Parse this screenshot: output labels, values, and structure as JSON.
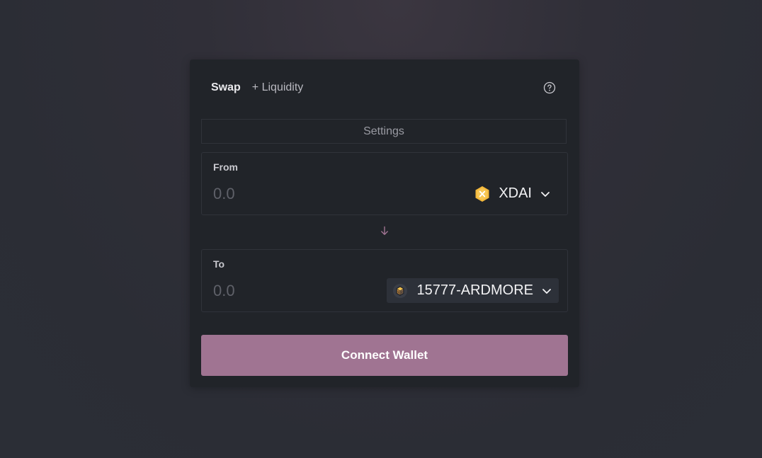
{
  "nav": {
    "tabs": [
      {
        "label": "Swap",
        "active": true
      },
      {
        "label": "+ Liquidity",
        "active": false
      }
    ],
    "help_icon": "question-circle-icon"
  },
  "settings": {
    "label": "Settings"
  },
  "from": {
    "label": "From",
    "amount_placeholder": "0.0",
    "amount_value": "",
    "token": {
      "symbol": "XDAI",
      "icon": "xdai-token-icon"
    }
  },
  "switch_icon": "arrow-down-icon",
  "to": {
    "label": "To",
    "amount_placeholder": "0.0",
    "amount_value": "",
    "token": {
      "symbol": "15777-ARDMORE",
      "icon": "ardmore-token-icon"
    }
  },
  "connect_button": {
    "label": "Connect Wallet"
  },
  "colors": {
    "accent": "#a07492",
    "card_background": "#212429",
    "page_background": "#2b2e36",
    "xdai_token": "#f5b93b"
  }
}
